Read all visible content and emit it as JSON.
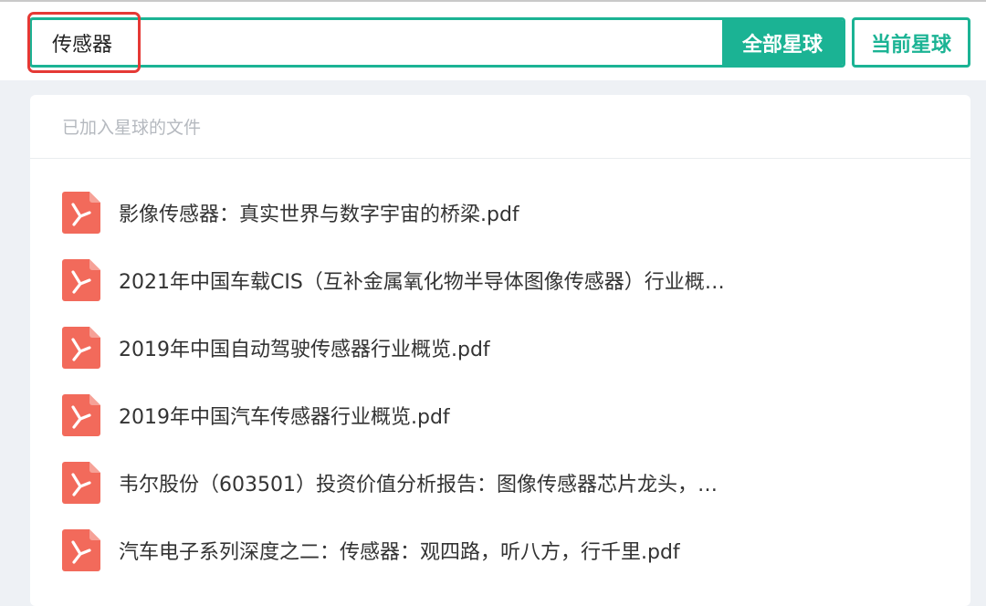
{
  "search": {
    "value": "传感器",
    "all_button": "全部星球",
    "current_button": "当前星球"
  },
  "panel": {
    "title": "已加入星球的文件",
    "files": [
      "影像传感器：真实世界与数字宇宙的桥梁.pdf",
      "2021年中国车载CIS（互补金属氧化物半导体图像传感器）行业概…",
      "2019年中国自动驾驶传感器行业概览.pdf",
      "2019年中国汽车传感器行业概览.pdf",
      "韦尔股份（603501）投资价值分析报告：图像传感器芯片龙头，…",
      "汽车电子系列深度之二：传感器：观四路，听八方，行千里.pdf"
    ]
  },
  "icons": {
    "file": "pdf-icon"
  },
  "colors": {
    "accent": "#1bb394",
    "pdf": "#f26a5b",
    "highlight": "#e53935"
  }
}
